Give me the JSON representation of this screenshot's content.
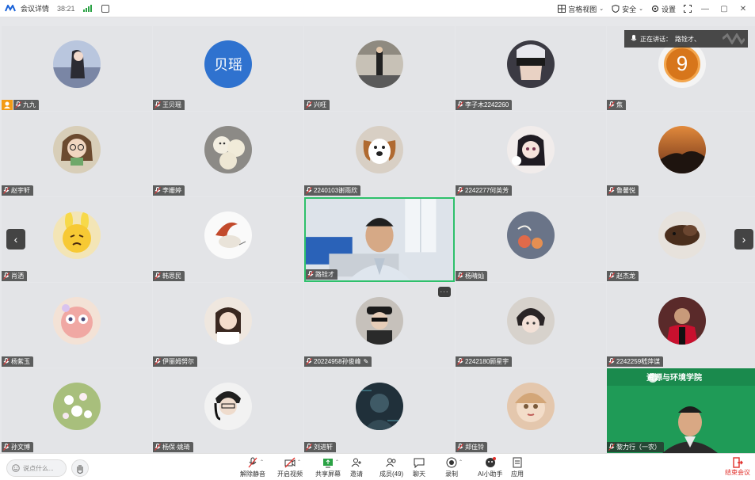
{
  "titlebar": {
    "title": "会议详情",
    "time": "38:21",
    "right": {
      "gallery": "宫格视图",
      "security": "安全",
      "settings": "设置"
    },
    "win": {
      "minimize": "—",
      "restore": "▢",
      "close": "✕"
    }
  },
  "speaking": {
    "label": "正在讲话：",
    "name": "路铨才、"
  },
  "participants": [
    {
      "name": "九九",
      "avatar": "avatar-anime-girl",
      "host": true
    },
    {
      "name": "王贝瑶",
      "avatar": "avatar-text",
      "text": "贝瑶",
      "color": "#2f72cf"
    },
    {
      "name": "兴旺",
      "avatar": "avatar-street-photo"
    },
    {
      "name": "李子木2242260",
      "avatar": "avatar-anime-masked"
    },
    {
      "name": "焦",
      "avatar": "avatar-number",
      "text": "9"
    },
    {
      "name": "赵宇轩",
      "avatar": "avatar-girl-glasses"
    },
    {
      "name": "李姗婷",
      "avatar": "avatar-bread-figures"
    },
    {
      "name": "2240103谢雨欣",
      "avatar": "avatar-dog-cartoon"
    },
    {
      "name": "2242277何英芳",
      "avatar": "avatar-anime-cat-girl"
    },
    {
      "name": "鲁馨悦",
      "avatar": "avatar-sunset-tree"
    },
    {
      "name": "肖洒",
      "avatar": "avatar-yellow-rabbit"
    },
    {
      "name": "韩思民",
      "avatar": "avatar-gnome-sketch"
    },
    {
      "name": "路铨才",
      "avatar": "video",
      "active": true
    },
    {
      "name": "杨晴灿",
      "avatar": "avatar-fruit-art"
    },
    {
      "name": "赵杰龙",
      "avatar": "avatar-dog-photo"
    },
    {
      "name": "杨紫玉",
      "avatar": "avatar-pink-monster"
    },
    {
      "name": "伊丽姆努尔",
      "avatar": "avatar-girl-white"
    },
    {
      "name": "20224958孙俊峰",
      "avatar": "avatar-boy-hat",
      "editing": true
    },
    {
      "name": "2242180顾星宇",
      "avatar": "avatar-anime-boy"
    },
    {
      "name": "2242259嵇萍谋",
      "avatar": "avatar-soccer-player"
    },
    {
      "name": "孙文博",
      "avatar": "avatar-flowers"
    },
    {
      "name": "杨保·姚琦",
      "avatar": "avatar-boy-headphones"
    },
    {
      "name": "刘进轩",
      "avatar": "avatar-dark-figure"
    },
    {
      "name": "郑佳铃",
      "avatar": "avatar-doll-face"
    },
    {
      "name": "黎力行（一农）",
      "avatar": "video2",
      "banner": "资源与环境学院"
    }
  ],
  "bottombar": {
    "chat_placeholder": "说点什么...",
    "tools": [
      {
        "label": "解除静音",
        "icon": "mic-off-icon"
      },
      {
        "label": "开启视频",
        "icon": "camera-off-icon"
      },
      {
        "label": "共享屏幕",
        "icon": "share-screen-icon"
      },
      {
        "label": "邀请",
        "icon": "invite-icon"
      },
      {
        "label": "成员(49)",
        "icon": "members-icon"
      },
      {
        "label": "聊天",
        "icon": "chat-icon"
      },
      {
        "label": "录制",
        "icon": "record-icon"
      },
      {
        "label": "AI小助手",
        "icon": "ai-assistant-icon"
      },
      {
        "label": "应用",
        "icon": "apps-icon"
      }
    ],
    "end": "结束会议"
  },
  "colors": {
    "active_border": "#2ec06b",
    "host": "#f39b16",
    "end": "#e1302b"
  }
}
